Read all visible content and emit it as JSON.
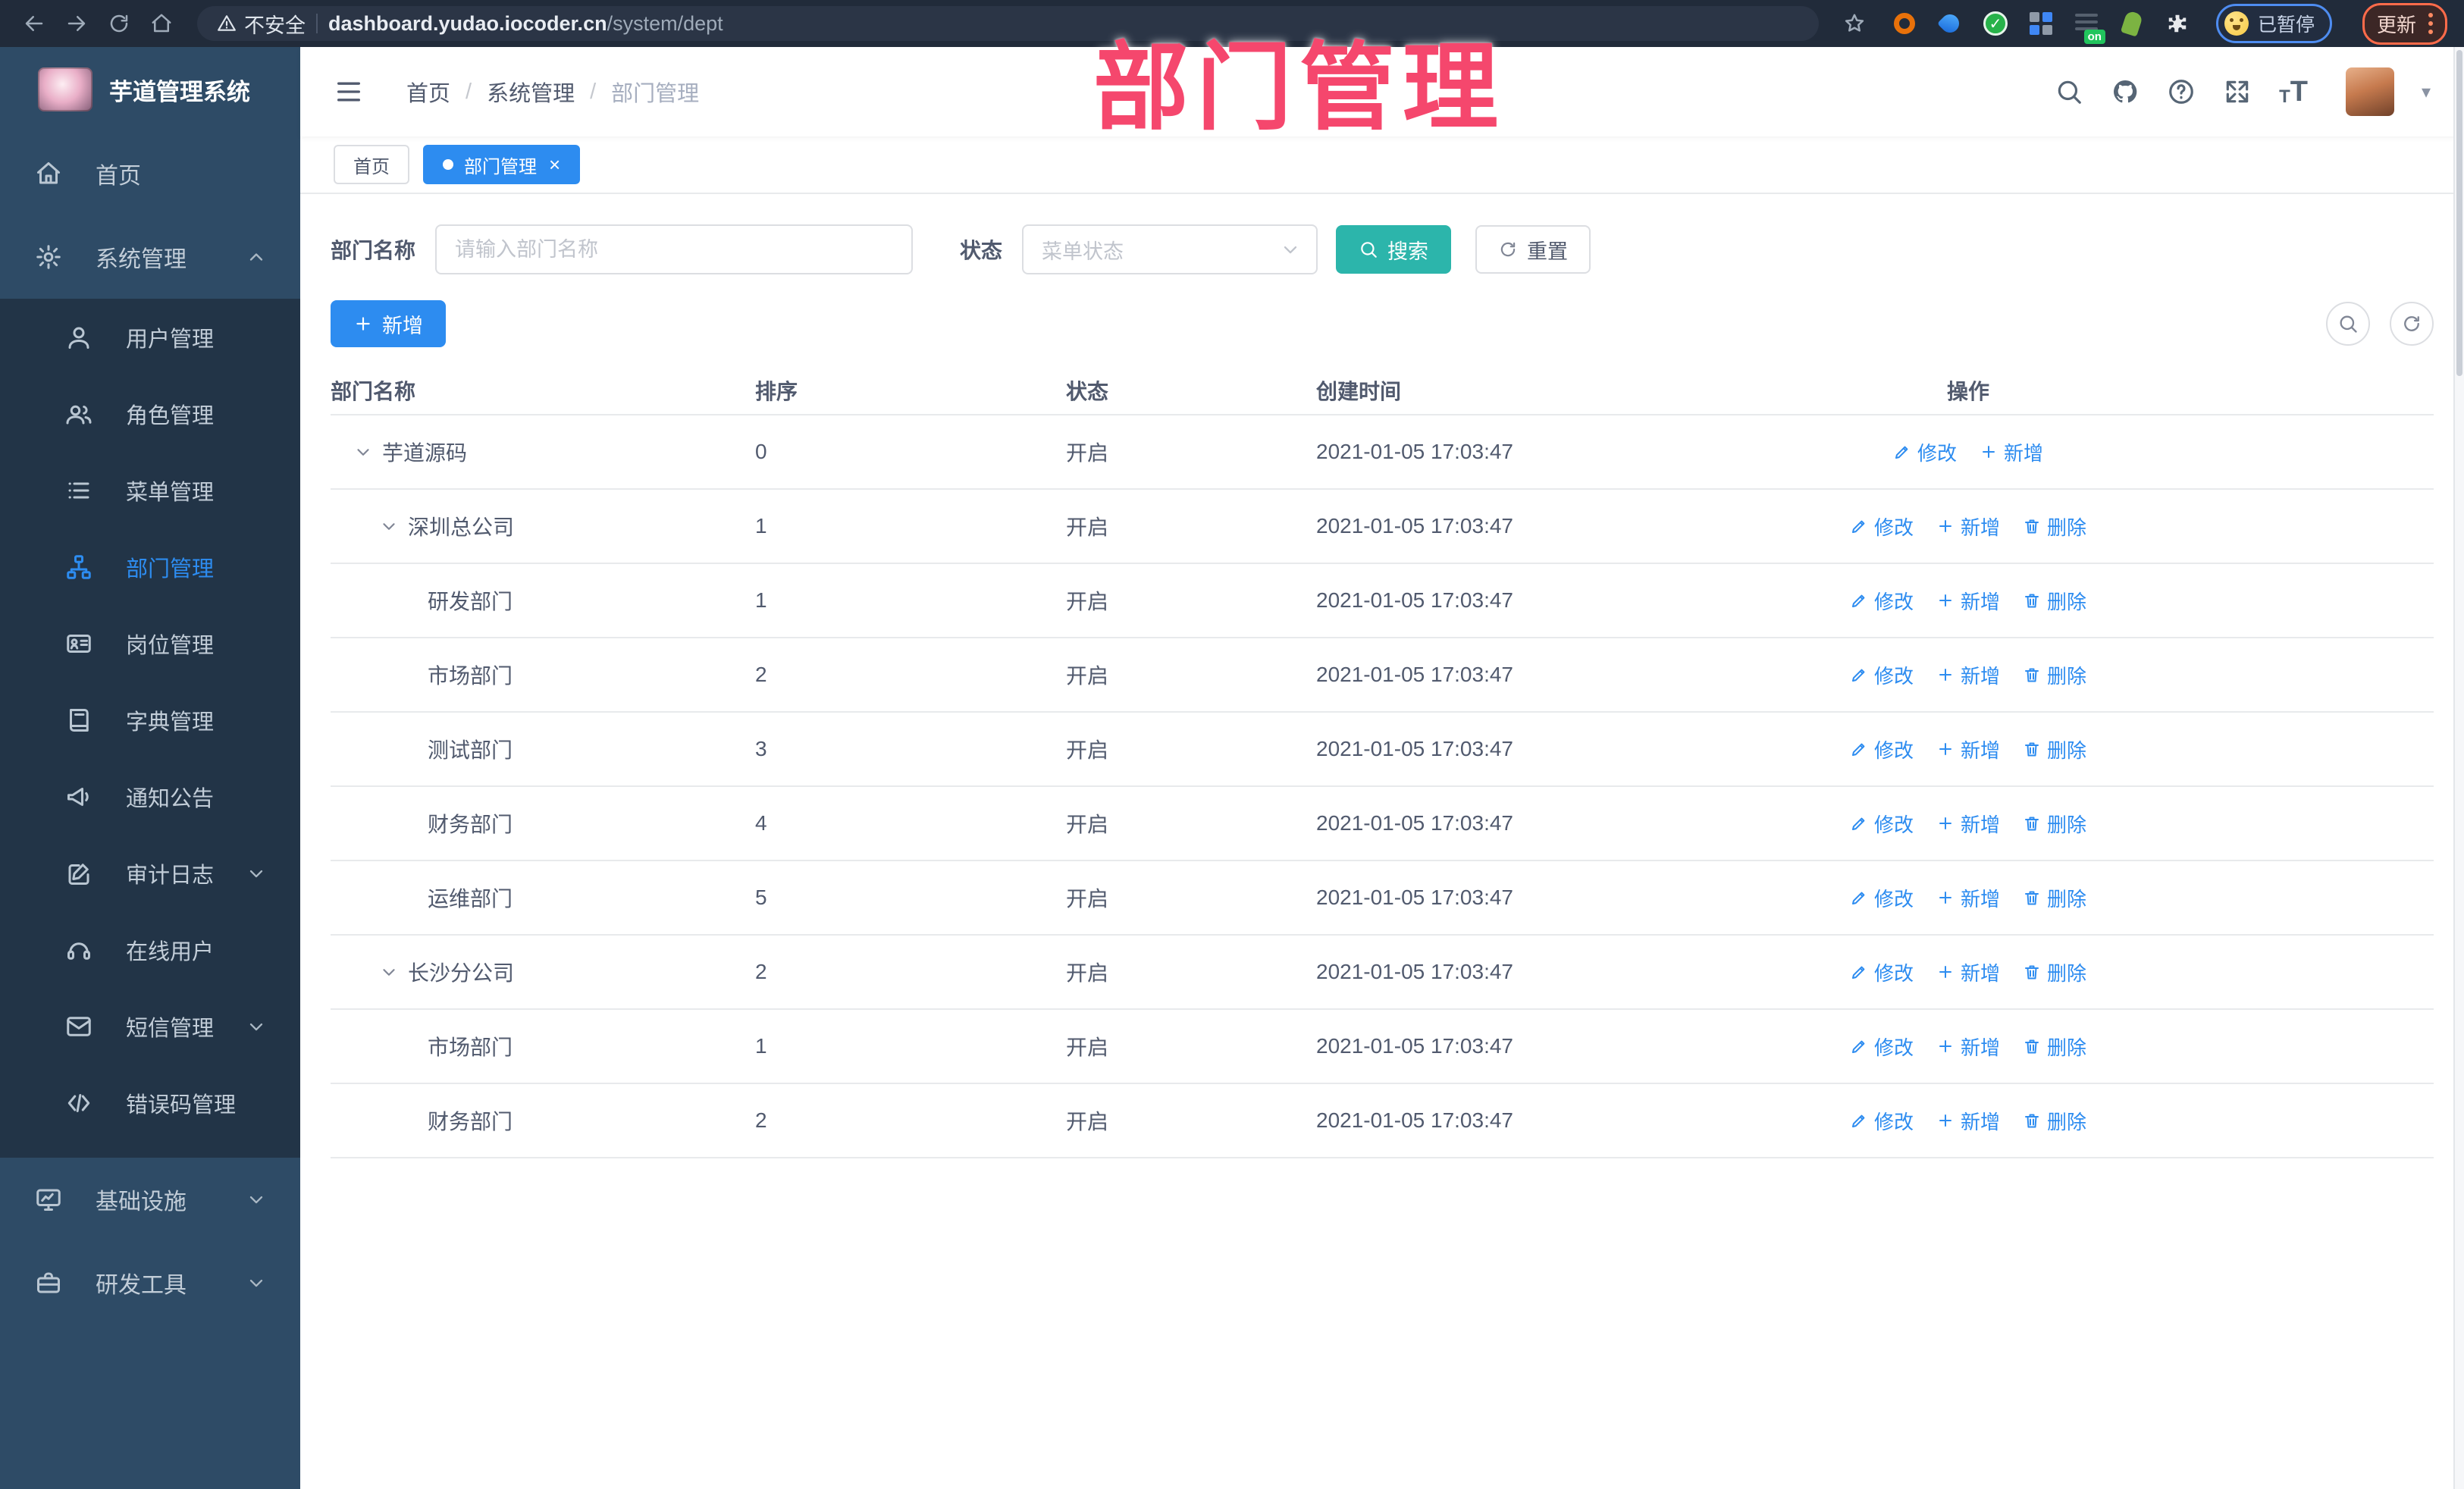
{
  "colors": {
    "accent_blue": "#2d8cf0",
    "search_teal": "#2cb5ab",
    "overlay_pink": "#f5476d",
    "sidebar_bg": "#2e4b66",
    "submenu_bg": "#223447",
    "browser_bar_bg": "#212b3a"
  },
  "overlay_title": "部门管理",
  "browser": {
    "security_label": "不安全",
    "url_host": "dashboard.yudao.iocoder.cn",
    "url_path": "/system/dept",
    "extension_icons": [
      "orange-ring",
      "blue-drop",
      "green-check",
      "blue-grid",
      "list-on",
      "green-figure",
      "puzzle"
    ],
    "extension_on_badge": "on",
    "paused_badge": "已暂停",
    "update_label": "更新"
  },
  "sidebar": {
    "app_title": "芋道管理系统",
    "items": [
      {
        "label": "首页",
        "icon": "home",
        "type": "top"
      },
      {
        "label": "系统管理",
        "icon": "gear",
        "type": "top",
        "chevron": "up",
        "expanded": true
      },
      {
        "label": "用户管理",
        "icon": "user",
        "type": "sub"
      },
      {
        "label": "角色管理",
        "icon": "users",
        "type": "sub"
      },
      {
        "label": "菜单管理",
        "icon": "menu-list",
        "type": "sub"
      },
      {
        "label": "部门管理",
        "icon": "org-tree",
        "type": "sub",
        "active": true
      },
      {
        "label": "岗位管理",
        "icon": "id-card",
        "type": "sub"
      },
      {
        "label": "字典管理",
        "icon": "book",
        "type": "sub"
      },
      {
        "label": "通知公告",
        "icon": "megaphone",
        "type": "sub"
      },
      {
        "label": "审计日志",
        "icon": "edit-log",
        "type": "sub",
        "chevron": "down"
      },
      {
        "label": "在线用户",
        "icon": "headset",
        "type": "sub"
      },
      {
        "label": "短信管理",
        "icon": "sms",
        "type": "sub",
        "chevron": "down"
      },
      {
        "label": "错误码管理",
        "icon": "code",
        "type": "sub"
      },
      {
        "label": "基础设施",
        "icon": "monitor",
        "type": "top",
        "chevron": "down"
      },
      {
        "label": "研发工具",
        "icon": "toolbox",
        "type": "top",
        "chevron": "down"
      }
    ]
  },
  "header": {
    "breadcrumbs": [
      "首页",
      "系统管理",
      "部门管理"
    ]
  },
  "tabs": [
    {
      "label": "首页",
      "active": false,
      "closable": false
    },
    {
      "label": "部门管理",
      "active": true,
      "closable": true
    }
  ],
  "filters": {
    "name_label": "部门名称",
    "name_placeholder": "请输入部门名称",
    "status_label": "状态",
    "status_placeholder": "菜单状态",
    "search_label": "搜索",
    "reset_label": "重置"
  },
  "toolbar": {
    "add_label": "新增"
  },
  "table": {
    "headers": [
      "部门名称",
      "排序",
      "状态",
      "创建时间",
      "操作"
    ],
    "action_labels": {
      "edit": "修改",
      "add": "新增",
      "delete": "删除"
    },
    "rows": [
      {
        "name": "芋道源码",
        "level": 0,
        "expandable": true,
        "sort": "0",
        "status": "开启",
        "created": "2021-01-05 17:03:47",
        "actions": [
          "edit",
          "add"
        ]
      },
      {
        "name": "深圳总公司",
        "level": 1,
        "expandable": true,
        "sort": "1",
        "status": "开启",
        "created": "2021-01-05 17:03:47",
        "actions": [
          "edit",
          "add",
          "delete"
        ]
      },
      {
        "name": "研发部门",
        "level": 2,
        "expandable": false,
        "sort": "1",
        "status": "开启",
        "created": "2021-01-05 17:03:47",
        "actions": [
          "edit",
          "add",
          "delete"
        ]
      },
      {
        "name": "市场部门",
        "level": 2,
        "expandable": false,
        "sort": "2",
        "status": "开启",
        "created": "2021-01-05 17:03:47",
        "actions": [
          "edit",
          "add",
          "delete"
        ]
      },
      {
        "name": "测试部门",
        "level": 2,
        "expandable": false,
        "sort": "3",
        "status": "开启",
        "created": "2021-01-05 17:03:47",
        "actions": [
          "edit",
          "add",
          "delete"
        ]
      },
      {
        "name": "财务部门",
        "level": 2,
        "expandable": false,
        "sort": "4",
        "status": "开启",
        "created": "2021-01-05 17:03:47",
        "actions": [
          "edit",
          "add",
          "delete"
        ]
      },
      {
        "name": "运维部门",
        "level": 2,
        "expandable": false,
        "sort": "5",
        "status": "开启",
        "created": "2021-01-05 17:03:47",
        "actions": [
          "edit",
          "add",
          "delete"
        ]
      },
      {
        "name": "长沙分公司",
        "level": 1,
        "expandable": true,
        "sort": "2",
        "status": "开启",
        "created": "2021-01-05 17:03:47",
        "actions": [
          "edit",
          "add",
          "delete"
        ]
      },
      {
        "name": "市场部门",
        "level": 2,
        "expandable": false,
        "sort": "1",
        "status": "开启",
        "created": "2021-01-05 17:03:47",
        "actions": [
          "edit",
          "add",
          "delete"
        ]
      },
      {
        "name": "财务部门",
        "level": 2,
        "expandable": false,
        "sort": "2",
        "status": "开启",
        "created": "2021-01-05 17:03:47",
        "actions": [
          "edit",
          "add",
          "delete"
        ]
      }
    ]
  }
}
